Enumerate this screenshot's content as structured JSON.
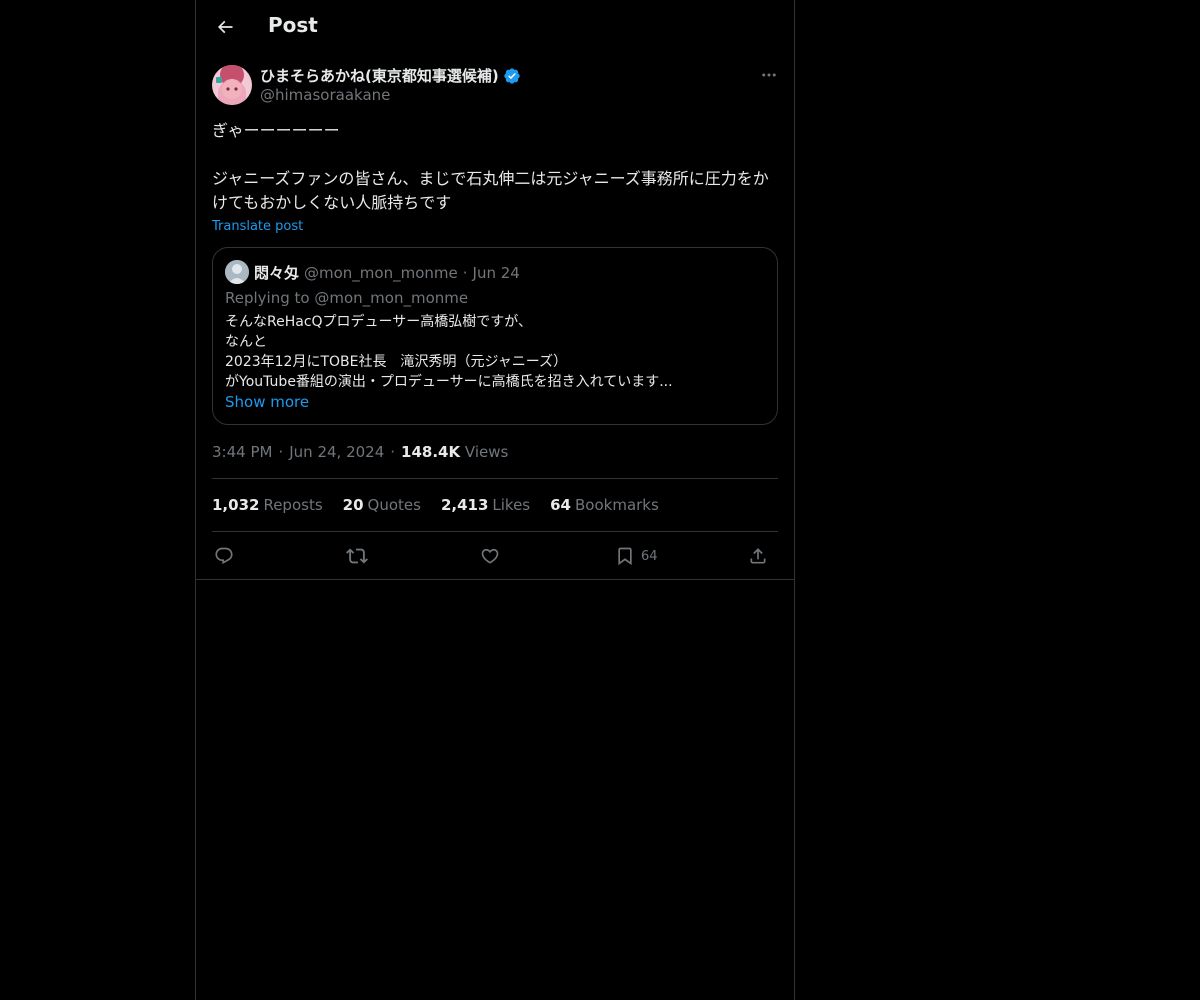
{
  "header": {
    "title": "Post"
  },
  "post": {
    "author": {
      "display_name": "ひまそらあかね(東京都知事選候補)",
      "handle": "@himasoraakane",
      "verified": true
    },
    "text": "ぎゃーーーーーー\n\nジャニーズファンの皆さん、まじで石丸伸二は元ジャニーズ事務所に圧力をかけてもおかしくない人脈持ちです",
    "translate_label": "Translate post",
    "quote": {
      "display_name": "悶々匁",
      "handle": "@mon_mon_monme",
      "separator": "·",
      "date": "Jun 24",
      "replying_prefix": "Replying to",
      "replying_to": "@mon_mon_monme",
      "text": "そんなReHacQプロデューサー高橋弘樹ですが、\nなんと\n2023年12月にTOBE社長　滝沢秀明（元ジャニーズ）\nがYouTube番組の演出・プロデューサーに高橋氏を招き入れています...",
      "show_more": "Show more"
    },
    "time": "3:44 PM",
    "separator": "·",
    "date": "Jun 24, 2024",
    "views_count": "148.4K",
    "views_label": "Views",
    "stats": [
      {
        "count": "1,032",
        "label": "Reposts"
      },
      {
        "count": "20",
        "label": "Quotes"
      },
      {
        "count": "2,413",
        "label": "Likes"
      },
      {
        "count": "64",
        "label": "Bookmarks"
      }
    ],
    "actions": {
      "bookmark_count": "64"
    }
  },
  "colors": {
    "background": "#000000",
    "text": "#e7e9ea",
    "secondary": "#71767b",
    "accent": "#1d9bf0",
    "border": "#2f3336"
  },
  "icons": [
    "back-arrow-icon",
    "verified-badge-icon",
    "more-icon",
    "reply-icon",
    "repost-icon",
    "like-icon",
    "bookmark-icon",
    "share-icon"
  ]
}
